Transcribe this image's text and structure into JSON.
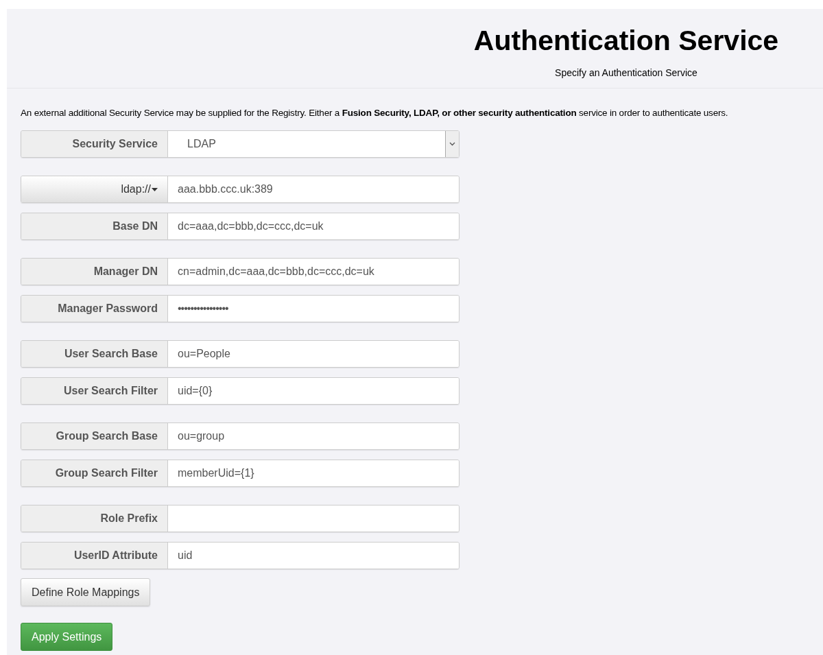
{
  "header": {
    "title": "Authentication Service",
    "subtitle": "Specify an Authentication Service"
  },
  "intro": "An external additional Security Service may be supplied for the Registry. Either a **Fusion Security, LDAP, or other security authentication** service in order to authenticate users.",
  "groups": [
    [
      {
        "kind": "select",
        "label": "Security Service",
        "value": "LDAP"
      }
    ],
    [
      {
        "kind": "addon-dropdown",
        "label": "ldap://",
        "value": "aaa.bbb.ccc.uk:389"
      },
      {
        "kind": "text",
        "label": "Base DN",
        "value": "dc=aaa,dc=bbb,dc=ccc,dc=uk"
      }
    ],
    [
      {
        "kind": "text",
        "label": "Manager DN",
        "value": "cn=admin,dc=aaa,dc=bbb,dc=ccc,dc=uk"
      },
      {
        "kind": "password",
        "label": "Manager Password",
        "value": "••••••••••••••••"
      }
    ],
    [
      {
        "kind": "text",
        "label": "User Search Base",
        "value": "ou=People"
      },
      {
        "kind": "text",
        "label": "User Search Filter",
        "value": "uid={0}"
      }
    ],
    [
      {
        "kind": "text",
        "label": "Group Search Base",
        "value": "ou=group"
      },
      {
        "kind": "text",
        "label": "Group Search Filter",
        "value": "memberUid={1}"
      }
    ],
    [
      {
        "kind": "text",
        "label": "Role Prefix"
      },
      {
        "kind": "text",
        "label": "UserID Attribute",
        "value": "uid"
      }
    ]
  ],
  "buttons": [
    {
      "kind": "default",
      "label": "Define Role Mappings"
    },
    {
      "kind": "primary",
      "label": "Apply Settings"
    }
  ]
}
